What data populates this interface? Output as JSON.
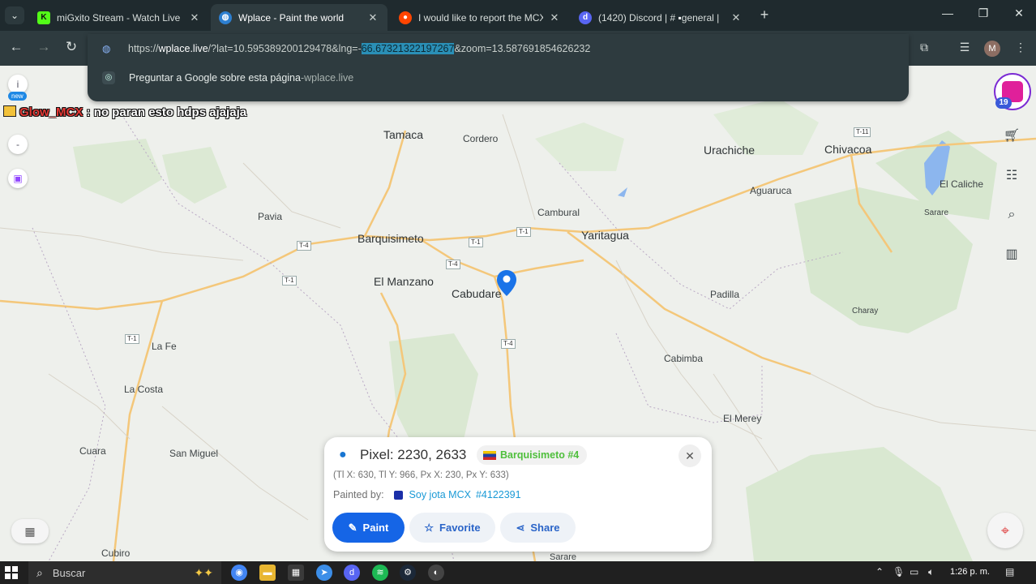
{
  "browser": {
    "tabs": [
      {
        "title": "miGxito Stream - Watch Live on",
        "favicon": "kick-icon",
        "color": "#53fc18"
      },
      {
        "title": "Wplace - Paint the world",
        "favicon": "globe-icon",
        "active": true
      },
      {
        "title": "I would like to report the MCX",
        "favicon": "reddit-icon",
        "color": "#ff4500"
      },
      {
        "title": "(1420) Discord | #",
        "favicon": "discord-icon",
        "suffix": "general |"
      }
    ],
    "url": {
      "prefix": "https://",
      "host": "wplace.live",
      "path_before": "/?lat=10.595389200129478&lng=-",
      "selected": "66.67321322197267",
      "path_after": "&zoom=13.587691854626232"
    },
    "suggestion": {
      "text": "Preguntar a Google sobre esta página",
      "sep": " - ",
      "domain": "wplace.live"
    },
    "avatar_initial": "M"
  },
  "overlay": {
    "new_badge": "new",
    "info_btn": "i",
    "chat": {
      "user": "Glow_MCX",
      "separator": " : ",
      "message": "no paran esto hdps ajajaja"
    },
    "profile_level": "19"
  },
  "map": {
    "places": [
      {
        "name": "Tamaca",
        "big": true
      },
      {
        "name": "Cordero"
      },
      {
        "name": "Urachiche",
        "big": true
      },
      {
        "name": "Chivacoa",
        "big": true
      },
      {
        "name": "Aguaruca"
      },
      {
        "name": "El Caliche"
      },
      {
        "name": "Sarare"
      },
      {
        "name": "Pavia"
      },
      {
        "name": "Cambural"
      },
      {
        "name": "Barquisimeto",
        "big": true
      },
      {
        "name": "Yaritagua",
        "big": true
      },
      {
        "name": "El Manzano",
        "big": true
      },
      {
        "name": "Cabudare",
        "big": true
      },
      {
        "name": "Padilla"
      },
      {
        "name": "Charay"
      },
      {
        "name": "La Fe"
      },
      {
        "name": "Cabimba"
      },
      {
        "name": "La Costa"
      },
      {
        "name": "El Merey"
      },
      {
        "name": "Cuara"
      },
      {
        "name": "San Miguel"
      },
      {
        "name": "Cubiro"
      },
      {
        "name": "Sarare"
      }
    ],
    "routes": [
      "T-11",
      "T-4",
      "T-1",
      "T-1",
      "T-4",
      "T-1",
      "T-1",
      "T-4"
    ]
  },
  "pixel_panel": {
    "title": "Pixel: 2230, 2633",
    "region": "Barquisimeto #4",
    "coords": "(Tl X: 630, Tl Y: 966, Px X: 230, Px Y: 633)",
    "painted_by_label": "Painted by:",
    "painter": "Soy jota MCX",
    "painter_id": "#4122391",
    "buttons": {
      "paint": "Paint",
      "favorite": "Favorite",
      "share": "Share"
    }
  },
  "taskbar": {
    "search_placeholder": "Buscar",
    "time": "1:26 p. m."
  }
}
